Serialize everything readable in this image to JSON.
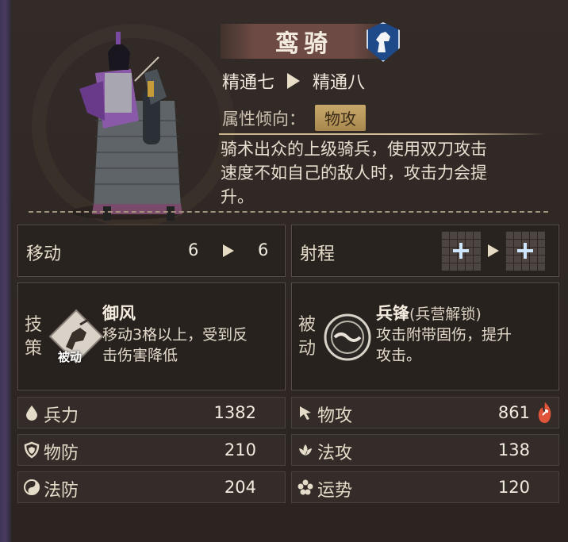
{
  "unit": {
    "name": "鸾骑",
    "class_icon": "horse-head-icon",
    "mastery_from": "精通七",
    "mastery_to": "精通八",
    "attr_label": "属性倾向：",
    "attr_value": "物攻",
    "desc_lines": [
      "骑术出众的上级骑兵，使用双刀攻击",
      "速度不如自己的敌人时，攻击力会提",
      "升。"
    ]
  },
  "movement": {
    "label": "移动",
    "from": "6",
    "to": "6"
  },
  "range": {
    "label": "射程"
  },
  "tactic": {
    "side_label": [
      "技",
      "策"
    ],
    "name": "御风",
    "badge": "被动",
    "desc_lines": [
      "移动3格以上，受到反",
      "击伤害降低"
    ]
  },
  "passive": {
    "side_label": [
      "被",
      "动"
    ],
    "name": "兵锋",
    "sub": "(兵营解锁)",
    "desc_lines": [
      "攻击附带固伤，提升",
      "攻击。"
    ]
  },
  "stats": {
    "troops": {
      "label": "兵力",
      "value": "1382",
      "icon": "water-drop-icon"
    },
    "phys_atk": {
      "label": "物攻",
      "value": "861",
      "icon": "cursor-arrow-icon"
    },
    "phys_def": {
      "label": "物防",
      "value": "210",
      "icon": "shield-icon"
    },
    "mag_atk": {
      "label": "法攻",
      "value": "138",
      "icon": "lotus-icon"
    },
    "mag_def": {
      "label": "法防",
      "value": "204",
      "icon": "yin-yang-icon"
    },
    "luck": {
      "label": "运势",
      "value": "120",
      "icon": "flower-icon"
    }
  },
  "colors": {
    "accent_gold": "#c9a96a",
    "class_blue": "#1f4a8a",
    "boost_red": "#e0553a"
  }
}
